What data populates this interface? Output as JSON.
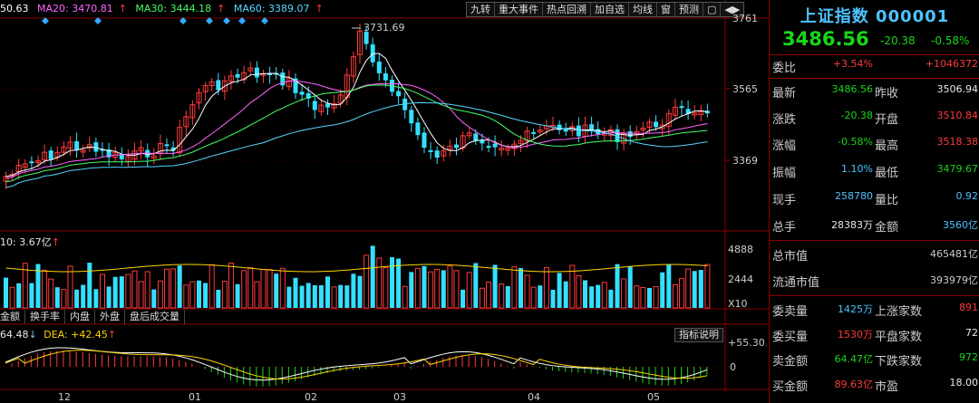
{
  "colors": {
    "up": "#ff3b3b",
    "down": "#33e0ff",
    "volume": "#33e0ff",
    "ma5": "#ffffff",
    "ma20": "#ff66ff",
    "ma30": "#44ff66",
    "ma60": "#55d7ff",
    "macd_pos": "#ff3b3b",
    "macd_neg": "#19d619",
    "border": "#8b0000"
  },
  "ma_legend": {
    "ma5": "50.63",
    "ma20": "MA20: 3470.81",
    "ma30": "MA30: 3444.18",
    "ma60": "MA60: 3389.07",
    "arrow": "↑"
  },
  "toolbar": [
    "九转",
    "重大事件",
    "热点回溯",
    "加自选",
    "均线",
    "窗",
    "预测",
    "▢",
    "◀▶"
  ],
  "toolbar_icons": [
    "nine-turn-icon",
    "event-icon",
    "hotspot-icon",
    "add-watch-icon",
    "ma-icon",
    "window-icon",
    "forecast-icon",
    "square-icon",
    "arrows-icon"
  ],
  "price_axis": {
    "top": "3761",
    "mid": "3565",
    "low": "3369"
  },
  "annotation_high": "3731.69",
  "volume_legend": {
    "text": "10: 3.67亿",
    "arrow": "↑"
  },
  "volume_axis": {
    "top": "4888",
    "mid": "2444",
    "unit": "X10"
  },
  "indicator_tabs": [
    "金额",
    "换手率",
    "内盘",
    "外盘",
    "盘后成交量"
  ],
  "macd_legend": {
    "dif": "64.48",
    "dif_arrow": "↓",
    "dea": "DEA: +42.45",
    "dea_arrow": "↑"
  },
  "indicator_explain": "指标说明",
  "macd_axis": {
    "top": "+55.30",
    "zero": "0"
  },
  "months": [
    "12",
    "01",
    "02",
    "03",
    "04",
    "05"
  ],
  "quote": {
    "title": "上证指数 000001",
    "price": "3486.56",
    "change": "-20.38",
    "change_pct": "-0.58%",
    "rows": [
      {
        "l1": "委比",
        "v1": "+3.54%",
        "l2": "",
        "v2": "+1046372",
        "c1": "c-red",
        "c2": "c-red"
      },
      {
        "l1": "最新",
        "v1": "3486.56",
        "l2": "昨收",
        "v2": "3506.94",
        "c1": "c-green",
        "c2": "c-white"
      },
      {
        "l1": "涨跌",
        "v1": "-20.38",
        "l2": "开盘",
        "v2": "3510.84",
        "c1": "c-green",
        "c2": "c-red"
      },
      {
        "l1": "涨幅",
        "v1": "-0.58%",
        "l2": "最高",
        "v2": "3518.38",
        "c1": "c-green",
        "c2": "c-red"
      },
      {
        "l1": "振幅",
        "v1": "1.10%",
        "l2": "最低",
        "v2": "3479.67",
        "c1": "c-cyan",
        "c2": "c-green"
      },
      {
        "l1": "现手",
        "v1": "258780",
        "l2": "量比",
        "v2": "0.92",
        "c1": "c-cyan",
        "c2": "c-cyan"
      },
      {
        "l1": "总手",
        "v1": "28383万",
        "l2": "金额",
        "v2": "3560亿",
        "c1": "c-white",
        "c2": "c-cyan"
      }
    ],
    "wide_rows": [
      {
        "label": "总市值",
        "value": "465481亿"
      },
      {
        "label": "流通市值",
        "value": "393979亿"
      }
    ],
    "rows2": [
      {
        "l1": "委卖量",
        "v1": "1425万",
        "l2": "上涨家数",
        "v2": "891",
        "c1": "c-cyan",
        "c2": "c-red"
      },
      {
        "l1": "委买量",
        "v1": "1530万",
        "l2": "平盘家数",
        "v2": "72",
        "c1": "c-red",
        "c2": "c-white"
      },
      {
        "l1": "卖金额",
        "v1": "64.47亿",
        "l2": "下跌家数",
        "v2": "972",
        "c1": "c-green",
        "c2": "c-green"
      },
      {
        "l1": "买金额",
        "v1": "89.63亿",
        "l2": "市盈",
        "v2": "18.00",
        "c1": "c-red",
        "c2": "c-white"
      }
    ]
  }
}
